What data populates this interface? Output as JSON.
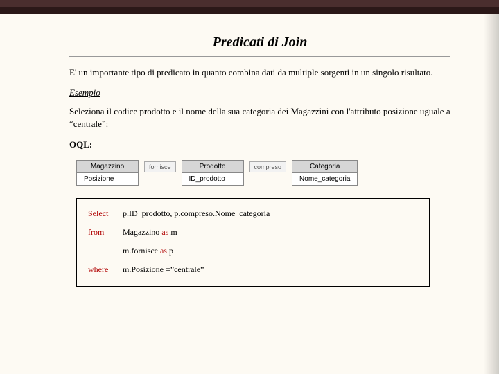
{
  "title": "Predicati di Join",
  "para1": "E' un importante tipo di predicato in quanto combina dati da multiple sorgenti in un singolo risultato.",
  "esempio_label": "Esempio",
  "para2": "Seleziona il codice prodotto e il nome della sua categoria dei Magazzini con l'attributo posizione uguale a “centrale”:",
  "oql_label": "OQL:",
  "diagram": {
    "entity1": {
      "name": "Magazzino",
      "field": "Posizione"
    },
    "rel1": "fornisce",
    "entity2": {
      "name": "Prodotto",
      "field": "ID_prodotto"
    },
    "rel2": "compreso",
    "entity3": {
      "name": "Categoria",
      "field": "Nome_categoria"
    }
  },
  "code": {
    "select_kw": "Select",
    "select_txt": "p.ID_prodotto, p.compreso.Nome_categoria",
    "from_kw": "from",
    "from_txt_pre": "Magazzino ",
    "as_kw": "as",
    "from_txt_post": " m",
    "line3_pre": "m.fornisce ",
    "line3_post": " p",
    "where_kw": "where",
    "where_txt": "m.Posizione =”centrale”"
  }
}
